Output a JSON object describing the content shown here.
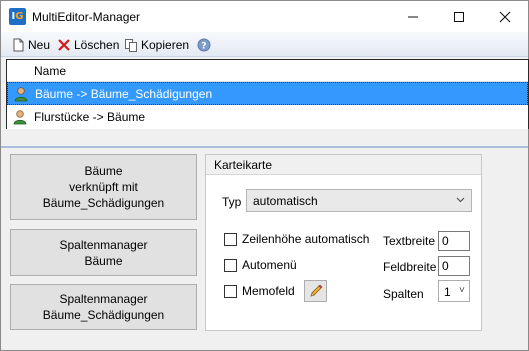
{
  "window": {
    "title": "MultiEditor-Manager",
    "icon_letters": "IG",
    "controls": [
      "minimize-icon",
      "maximize-icon",
      "close-icon"
    ]
  },
  "toolbar": {
    "new_label": "Neu",
    "delete_label": "Löschen",
    "copy_label": "Kopieren",
    "help_icon": "help-icon"
  },
  "list": {
    "header": "Name",
    "rows": [
      {
        "label": "Bäume -> Bäume_Schädigungen",
        "selected": true,
        "icon": "person-icon"
      },
      {
        "label": "Flurstücke -> Bäume",
        "selected": false,
        "icon": "person-icon"
      }
    ]
  },
  "actions": {
    "linked_button": "Bäume\nverknüpft mit\nBäume_Schädigungen",
    "column_manager_1": "Spaltenmanager\nBäume",
    "column_manager_2": "Spaltenmanager\nBäume_Schädigungen"
  },
  "karteikarte": {
    "title": "Karteikarte",
    "typ_label": "Typ",
    "typ_value": "automatisch",
    "checkboxes": [
      {
        "label": "Zeilenhöhe automatisch",
        "checked": false
      },
      {
        "label": "Automenü",
        "checked": false
      },
      {
        "label": "Memofeld",
        "checked": false
      }
    ],
    "textbreite_label": "Textbreite",
    "textbreite_value": "0",
    "feldbreite_label": "Feldbreite",
    "feldbreite_value": "0",
    "spalten_label": "Spalten",
    "spalten_value": "1"
  },
  "colors": {
    "selection": "#3399ff",
    "toolbar_gradient_top": "#f7f9fc",
    "toolbar_gradient_bottom": "#e4eaf3",
    "separator": "#a9bfdc"
  }
}
